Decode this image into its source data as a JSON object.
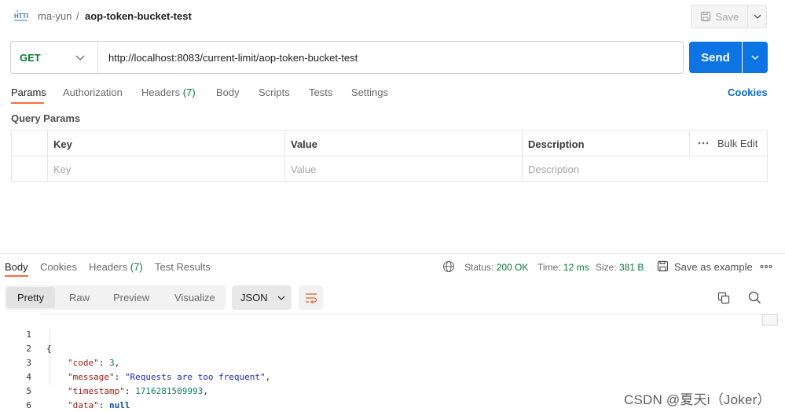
{
  "header": {
    "breadcrumb_parent": "ma-yun",
    "breadcrumb_sep": "/",
    "request_name": "aop-token-bucket-test",
    "save_label": "Save"
  },
  "request": {
    "method": "GET",
    "url": "http://localhost:8083/current-limit/aop-token-bucket-test",
    "send_label": "Send"
  },
  "request_tabs": {
    "params": "Params",
    "authorization": "Authorization",
    "headers": "Headers",
    "headers_count": "(7)",
    "body": "Body",
    "scripts": "Scripts",
    "tests": "Tests",
    "settings": "Settings",
    "cookies": "Cookies"
  },
  "query_params": {
    "title": "Query Params",
    "col_key": "Key",
    "col_value": "Value",
    "col_description": "Description",
    "bulk_edit": "Bulk Edit",
    "placeholder_key": "Key",
    "placeholder_value": "Value",
    "placeholder_description": "Description"
  },
  "response_tabs": {
    "body": "Body",
    "cookies": "Cookies",
    "headers": "Headers",
    "headers_count": "(7)",
    "test_results": "Test Results"
  },
  "response_meta": {
    "status_label": "Status:",
    "status_value": "200 OK",
    "time_label": "Time:",
    "time_value": "12 ms",
    "size_label": "Size:",
    "size_value": "381 B",
    "save_example": "Save as example"
  },
  "format_toolbar": {
    "pretty": "Pretty",
    "raw": "Raw",
    "preview": "Preview",
    "visualize": "Visualize",
    "language": "JSON"
  },
  "response_body": {
    "line_numbers": [
      "1",
      "2",
      "3",
      "4",
      "5",
      "6"
    ],
    "open_brace": "{",
    "close_brace": "}",
    "code_key": "\"code\"",
    "code_value": "3",
    "message_key": "\"message\"",
    "message_value": "\"Requests are too frequent\"",
    "timestamp_key": "\"timestamp\"",
    "timestamp_value": "1716281509993",
    "data_key": "\"data\"",
    "data_value": "null"
  },
  "watermark": "CSDN @夏天i（Joker）",
  "colors": {
    "accent": "#ff6c37",
    "send": "#0c74e3",
    "method_get": "#0b7a3b",
    "link": "#0c6bcb"
  }
}
